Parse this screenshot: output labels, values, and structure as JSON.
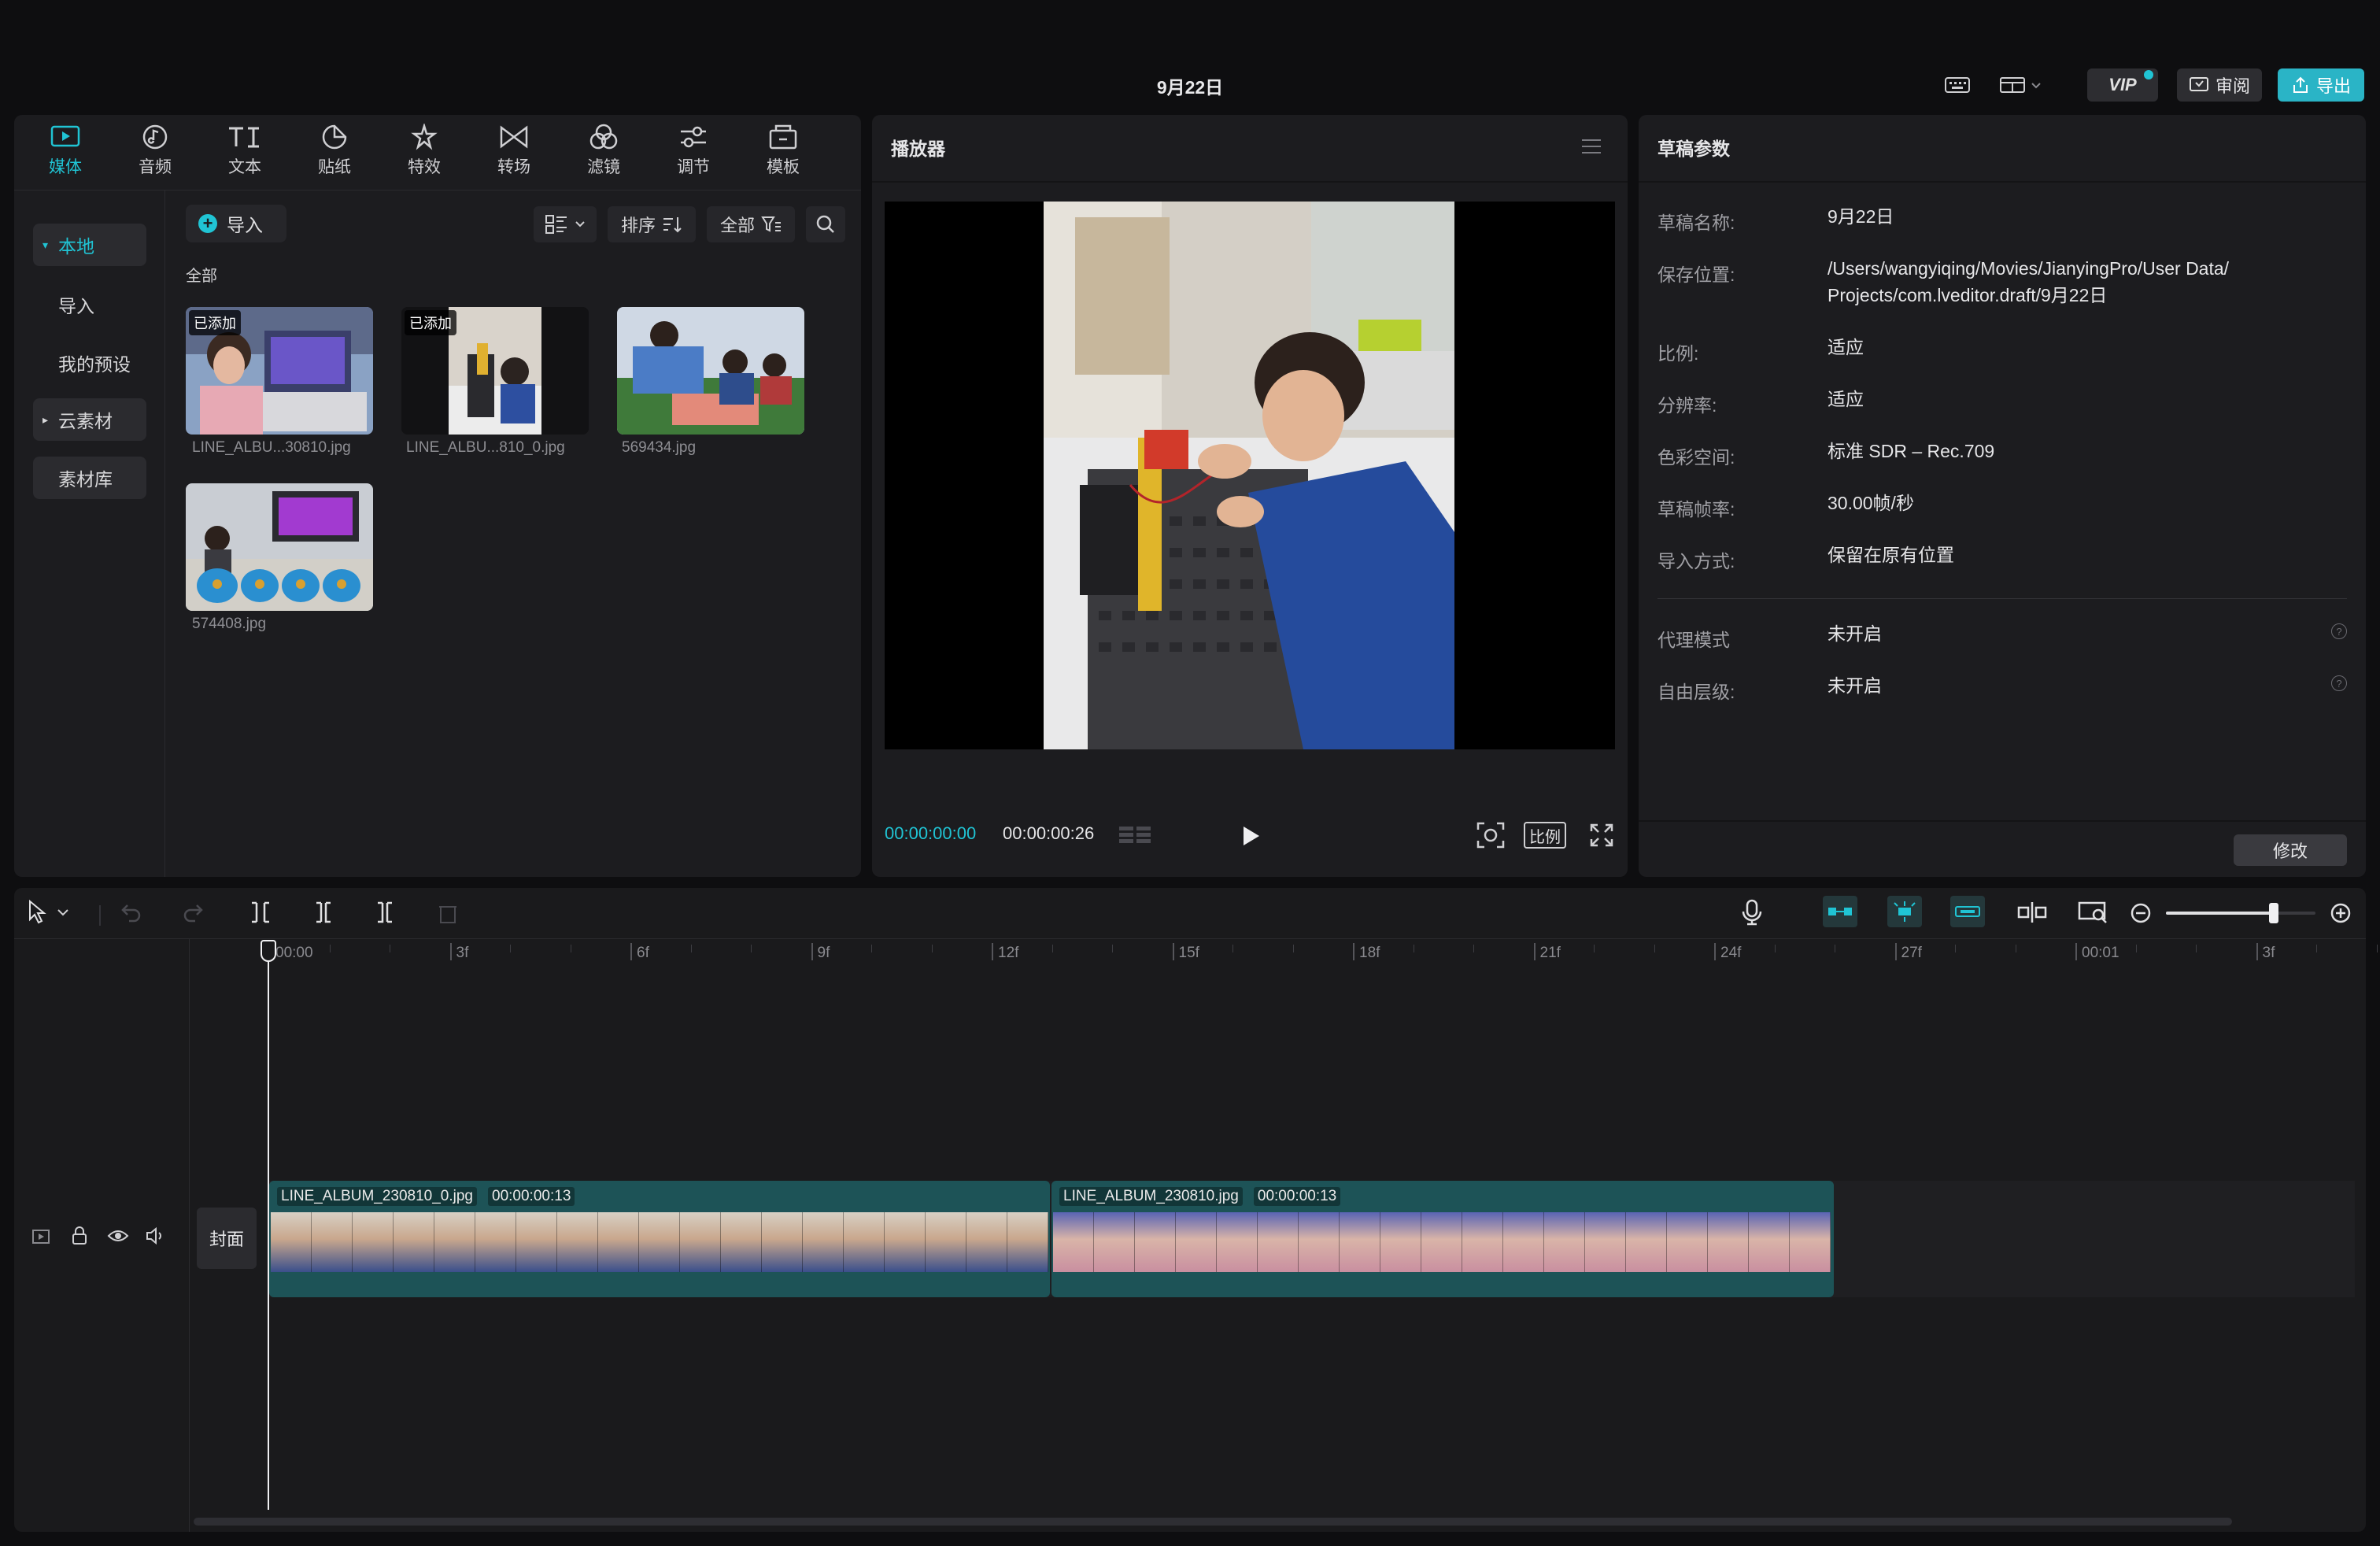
{
  "header": {
    "title": "9月22日",
    "vip_label": "VIP",
    "review_label": "审阅",
    "export_label": "导出"
  },
  "media_tabs": [
    {
      "label": "媒体",
      "icon": "media-icon",
      "active": true
    },
    {
      "label": "音频",
      "icon": "audio-icon"
    },
    {
      "label": "文本",
      "icon": "text-icon"
    },
    {
      "label": "贴纸",
      "icon": "sticker-icon"
    },
    {
      "label": "特效",
      "icon": "effects-icon"
    },
    {
      "label": "转场",
      "icon": "transition-icon"
    },
    {
      "label": "滤镜",
      "icon": "filter-icon"
    },
    {
      "label": "调节",
      "icon": "adjust-icon"
    },
    {
      "label": "模板",
      "icon": "template-icon"
    }
  ],
  "media_sidebar": {
    "local": "本地",
    "import": "导入",
    "my_presets": "我的预设",
    "cloud": "云素材",
    "library": "素材库"
  },
  "media_toolbar": {
    "import_label": "导入",
    "sort_label": "排序",
    "filter_label": "全部",
    "section_label": "全部"
  },
  "media_items": [
    {
      "name": "LINE_ALBU...30810.jpg",
      "added": "已添加"
    },
    {
      "name": "LINE_ALBU...810_0.jpg",
      "added": "已添加"
    },
    {
      "name": "569434.jpg",
      "added": ""
    },
    {
      "name": "574408.jpg",
      "added": ""
    }
  ],
  "player": {
    "title": "播放器",
    "current_time": "00:00:00:00",
    "total_time": "00:00:00:26",
    "ratio_label": "比例"
  },
  "props": {
    "title": "草稿参数",
    "rows": [
      {
        "key": "草稿名称:",
        "value": "9月22日"
      },
      {
        "key": "保存位置:",
        "value": "/Users/wangyiqing/Movies/JianyingPro/User Data/ Projects/com.lveditor.draft/9月22日"
      },
      {
        "key": "比例:",
        "value": "适应"
      },
      {
        "key": "分辨率:",
        "value": "适应"
      },
      {
        "key": "色彩空间:",
        "value": "标准 SDR – Rec.709"
      },
      {
        "key": "草稿帧率:",
        "value": "30.00帧/秒"
      },
      {
        "key": "导入方式:",
        "value": "保留在原有位置"
      },
      {
        "key": "代理模式",
        "value": "未开启"
      },
      {
        "key": "自由层级:",
        "value": "未开启"
      }
    ],
    "modify_label": "修改"
  },
  "timeline": {
    "ruler": [
      "00:00",
      "3f",
      "6f",
      "9f",
      "12f",
      "15f",
      "18f",
      "21f",
      "24f",
      "27f",
      "00:01",
      "3f"
    ],
    "cover_label": "封面",
    "zoom_level": 0.72,
    "clips": [
      {
        "name": "LINE_ALBUM_230810_0.jpg",
        "duration": "00:00:00:13"
      },
      {
        "name": "LINE_ALBUM_230810.jpg",
        "duration": "00:00:00:13"
      }
    ]
  },
  "colors": {
    "accent": "#20c4d4",
    "clip": "#1d5357",
    "panel": "#1c1c1f"
  }
}
